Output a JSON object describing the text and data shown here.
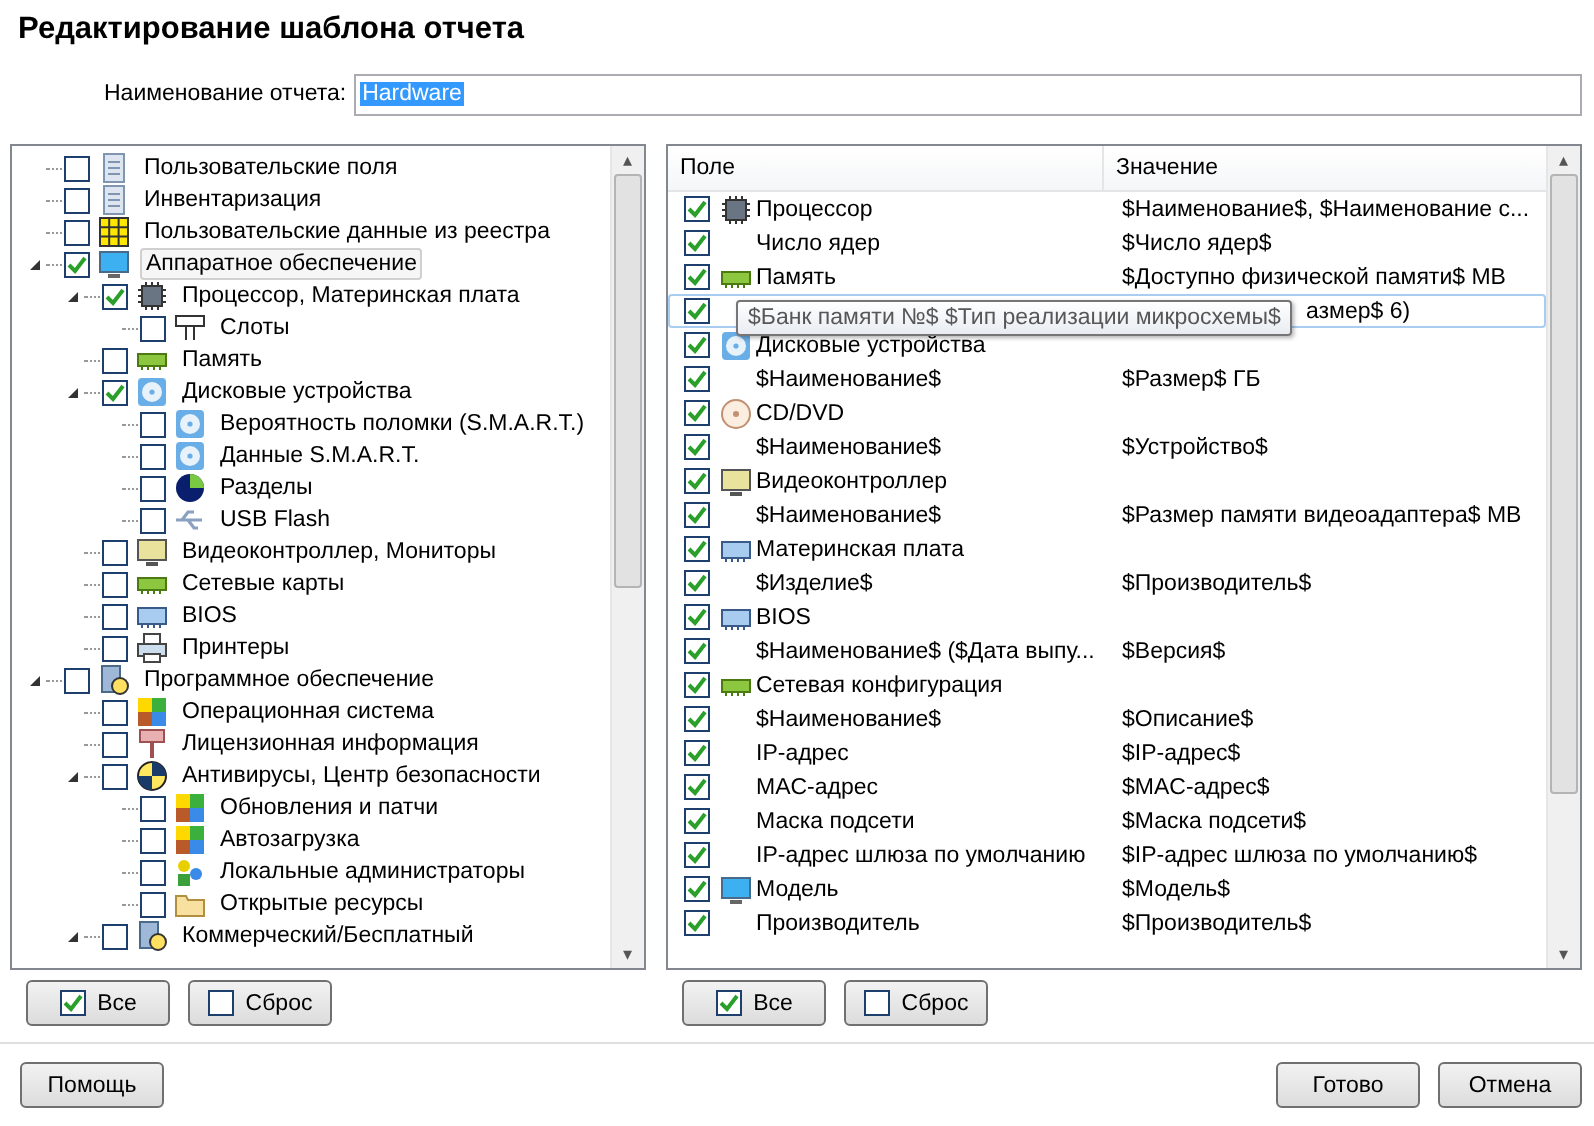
{
  "title": "Редактирование шаблона отчета",
  "name_field": {
    "label": "Наименование отчета:",
    "value": "Hardware"
  },
  "tree": [
    {
      "label": "Пользовательские поля",
      "kind": "doc",
      "checked": false
    },
    {
      "label": "Инвентаризация",
      "kind": "doc",
      "checked": false
    },
    {
      "label": "Пользовательские данные из реестра",
      "kind": "grid",
      "checked": false
    },
    {
      "label": "Аппаратное обеспечение",
      "kind": "monitor",
      "checked": true,
      "selected": true,
      "expanded": true,
      "children": [
        {
          "label": "Процессор, Материнская плата",
          "kind": "chip",
          "checked": true,
          "expanded": true,
          "children": [
            {
              "label": "Слоты",
              "kind": "slot",
              "checked": false
            }
          ]
        },
        {
          "label": "Память",
          "kind": "ram",
          "checked": false
        },
        {
          "label": "Дисковые устройства",
          "kind": "disk",
          "checked": true,
          "expanded": true,
          "children": [
            {
              "label": "Вероятность поломки (S.M.A.R.T.)",
              "kind": "disk",
              "checked": false
            },
            {
              "label": "Данные S.M.A.R.T.",
              "kind": "disk",
              "checked": false
            },
            {
              "label": "Разделы",
              "kind": "pie",
              "checked": false
            },
            {
              "label": "USB Flash",
              "kind": "usb",
              "checked": false
            }
          ]
        },
        {
          "label": "Видеоконтроллер, Мониторы",
          "kind": "display",
          "checked": false
        },
        {
          "label": "Сетевые карты",
          "kind": "ram",
          "checked": false
        },
        {
          "label": "BIOS",
          "kind": "bios",
          "checked": false
        },
        {
          "label": "Принтеры",
          "kind": "printer",
          "checked": false
        }
      ]
    },
    {
      "label": "Программное обеспечение",
      "kind": "software",
      "checked": false,
      "expanded": true,
      "children": [
        {
          "label": "Операционная система",
          "kind": "windows",
          "checked": false
        },
        {
          "label": "Лицензионная информация",
          "kind": "key",
          "checked": false
        },
        {
          "label": "Антивирусы, Центр безопасности",
          "kind": "shield",
          "checked": false,
          "expanded": true,
          "children": [
            {
              "label": "Обновления и патчи",
              "kind": "windows",
              "checked": false
            },
            {
              "label": "Автозагрузка",
              "kind": "windows",
              "checked": false
            },
            {
              "label": "Локальные администраторы",
              "kind": "users",
              "checked": false
            },
            {
              "label": "Открытые ресурсы",
              "kind": "folder",
              "checked": false
            }
          ]
        },
        {
          "label": "Коммерческий/Бесплатный",
          "kind": "software",
          "checked": false,
          "expanded": true
        }
      ]
    }
  ],
  "left_buttons": [
    {
      "label": "Все",
      "checked": true
    },
    {
      "label": "Сброс",
      "checked": false
    }
  ],
  "columns": [
    "Поле",
    "Значение"
  ],
  "rows": [
    {
      "kind": "chip",
      "field": "Процессор",
      "value": "$Наименование$, $Наименование с...",
      "checked": true,
      "selected": false
    },
    {
      "kind": "plain",
      "field": "Число ядер",
      "value": "$Число ядер$",
      "checked": true,
      "selected": false
    },
    {
      "kind": "ram",
      "field": "Память",
      "value": "$Доступно физической памяти$ MB",
      "checked": true,
      "selected": false
    },
    {
      "kind": "plain",
      "value": "азмер$ 6)",
      "checked": true,
      "selected": true
    },
    {
      "kind": "disk",
      "field": "Дисковые устройства",
      "checked": true,
      "selected": false
    },
    {
      "kind": "plain",
      "field": "$Наименование$",
      "value": "$Размер$ ГБ",
      "checked": true,
      "selected": false
    },
    {
      "kind": "cd",
      "field": "CD/DVD",
      "checked": true,
      "selected": false
    },
    {
      "kind": "plain",
      "field": "$Наименование$",
      "value": "$Устройство$",
      "checked": true,
      "selected": false
    },
    {
      "kind": "display",
      "field": "Видеоконтроллер",
      "checked": true,
      "selected": false
    },
    {
      "kind": "plain",
      "field": "$Наименование$",
      "value": "$Размер памяти видеоадаптера$ MB",
      "checked": true,
      "selected": false
    },
    {
      "kind": "bios",
      "field": "Материнская плата",
      "checked": true,
      "selected": false
    },
    {
      "kind": "plain",
      "field": "$Изделие$",
      "value": "$Производитель$",
      "checked": true,
      "selected": false
    },
    {
      "kind": "bios",
      "field": "BIOS",
      "checked": true,
      "selected": false
    },
    {
      "kind": "plain",
      "field": "$Наименование$ ($Дата выпу...",
      "value": "$Версия$",
      "checked": true,
      "selected": false
    },
    {
      "kind": "ram",
      "field": "Сетевая конфигурация",
      "checked": true,
      "selected": false
    },
    {
      "kind": "plain",
      "field": "$Наименование$",
      "value": "$Описание$",
      "checked": true,
      "selected": false
    },
    {
      "kind": "plain",
      "field": "IP-адрес",
      "value": "$IP-адрес$",
      "checked": true,
      "selected": false
    },
    {
      "kind": "plain",
      "field": "MAC-адрес",
      "value": "$MAC-адрес$",
      "checked": true,
      "selected": false
    },
    {
      "kind": "plain",
      "field": "Маска подсети",
      "value": "$Маска подсети$",
      "checked": true,
      "selected": false
    },
    {
      "kind": "plain",
      "field": "IP-адрес шлюза по умолчанию",
      "value": "$IP-адрес шлюза по умолчанию$",
      "checked": true,
      "selected": false
    },
    {
      "kind": "monitor",
      "field": "Модель",
      "value": "$Модель$",
      "checked": true,
      "selected": false
    },
    {
      "kind": "plain",
      "field": "Производитель",
      "value": "$Производитель$",
      "checked": true,
      "selected": false
    }
  ],
  "scroll_arrows": [
    "▴",
    "▾"
  ],
  "tooltip": "$Банк памяти №$ $Тип реализации микросхемы$",
  "right_buttons": [
    {
      "label": "Все",
      "checked": true
    },
    {
      "label": "Сброс",
      "checked": false
    }
  ],
  "footer_buttons": [
    "Помощь",
    "Готово",
    "Отмена"
  ]
}
